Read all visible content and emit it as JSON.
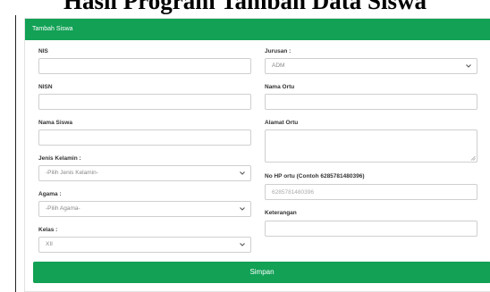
{
  "page_heading": "Hasil Program Tambah Data Siswa",
  "form": {
    "header": "Tambah Siswa",
    "nis": {
      "label": "NIS",
      "value": ""
    },
    "nisn": {
      "label": "NISN",
      "value": ""
    },
    "nama_siswa": {
      "label": "Nama Siswa",
      "value": ""
    },
    "jenis_kelamin": {
      "label": "Jenis Kelamin :",
      "selected": "-Pilih Jenis Kelamin-"
    },
    "agama": {
      "label": "Agama :",
      "selected": "-Pilih Agama-"
    },
    "kelas": {
      "label": "Kelas :",
      "selected": "XII"
    },
    "jurusan": {
      "label": "Jurusan :",
      "selected": "ADM"
    },
    "nama_ortu": {
      "label": "Nama Ortu",
      "value": ""
    },
    "alamat_ortu": {
      "label": "Alamat Ortu",
      "value": ""
    },
    "no_hp_ortu": {
      "label": "No HP ortu (Contoh 6285781480396)",
      "placeholder": "6285781480396"
    },
    "keterangan": {
      "label": "Keterangan",
      "value": ""
    },
    "submit_label": "Simpan"
  },
  "icons": {
    "select": "chevron-down-icon",
    "resize": "resize-grip-icon"
  },
  "colors": {
    "primary": "#12a155"
  }
}
